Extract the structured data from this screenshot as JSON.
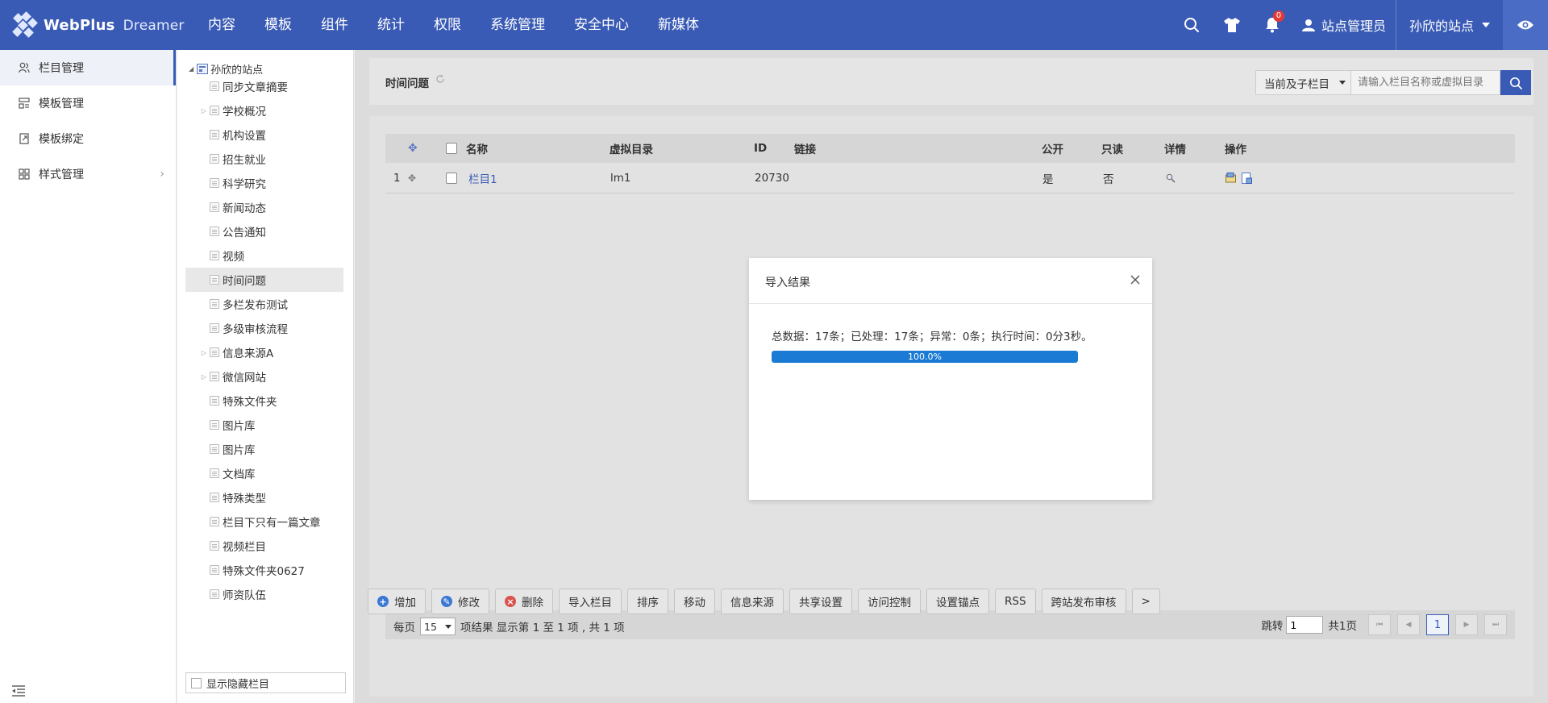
{
  "app": {
    "logo_name": "WebPlus",
    "logo_sub": "Dreamer"
  },
  "nav": {
    "items": [
      "内容",
      "模板",
      "组件",
      "统计",
      "权限",
      "系统管理",
      "安全中心",
      "新媒体"
    ]
  },
  "header": {
    "notification_count": "0",
    "user_name": "站点管理员",
    "site_name": "孙欣的站点"
  },
  "sidebar": {
    "items": [
      {
        "label": "栏目管理",
        "icon": "users-icon",
        "active": true
      },
      {
        "label": "模板管理",
        "icon": "template-icon"
      },
      {
        "label": "模板绑定",
        "icon": "bind-icon"
      },
      {
        "label": "样式管理",
        "icon": "style-icon",
        "has_children": true
      }
    ]
  },
  "tree": {
    "root": "孙欣的站点",
    "items": [
      {
        "label": "同步文章摘要"
      },
      {
        "label": "学校概况",
        "expandable": true
      },
      {
        "label": "机构设置"
      },
      {
        "label": "招生就业"
      },
      {
        "label": "科学研究"
      },
      {
        "label": "新闻动态"
      },
      {
        "label": "公告通知"
      },
      {
        "label": "视频"
      },
      {
        "label": "时间问题",
        "selected": true
      },
      {
        "label": "多栏发布测试"
      },
      {
        "label": "多级审核流程"
      },
      {
        "label": "信息来源A",
        "expandable": true
      },
      {
        "label": "微信网站",
        "expandable": true
      },
      {
        "label": "特殊文件夹"
      },
      {
        "label": "图片库"
      },
      {
        "label": "图片库"
      },
      {
        "label": "文档库"
      },
      {
        "label": "特殊类型"
      },
      {
        "label": "栏目下只有一篇文章"
      },
      {
        "label": "视频栏目"
      },
      {
        "label": "特殊文件夹0627"
      },
      {
        "label": "师资队伍"
      }
    ],
    "show_hidden_label": "显示隐藏栏目"
  },
  "main": {
    "title": "时间问题",
    "scope": "当前及子栏目",
    "search_placeholder": "请输入栏目名称或虚拟目录",
    "table": {
      "headers": {
        "name": "名称",
        "vdir": "虚拟目录",
        "id": "ID",
        "link": "链接",
        "public": "公开",
        "readonly": "只读",
        "detail": "详情",
        "ops": "操作"
      },
      "rows": [
        {
          "index": "1",
          "name": "栏目1",
          "vdir": "lm1",
          "id": "20730",
          "link": "",
          "public": "是",
          "readonly": "否"
        }
      ]
    },
    "pager": {
      "per_page_label": "每页",
      "per_page_value": "15",
      "summary": "项结果 显示第 1 至 1 项 , 共 1 项",
      "jump_label": "跳转",
      "jump_value": "1",
      "total_pages": "共1页",
      "current_page": "1"
    },
    "actions": {
      "add": "增加",
      "edit": "修改",
      "delete": "删除",
      "import": "导入栏目",
      "sort": "排序",
      "move": "移动",
      "source": "信息来源",
      "share": "共享设置",
      "access": "访问控制",
      "anchor": "设置锚点",
      "rss": "RSS",
      "cross": "跨站发布审核",
      "more": ">"
    }
  },
  "modal": {
    "title": "导入结果",
    "message": "总数据：17条；已处理：17条；异常：0条；执行时间：0分3秒。",
    "progress_label": "100.0%",
    "progress_value": 1.0
  },
  "colors": {
    "brand": "#3a5bb5",
    "progress": "#1a7ad4",
    "badge": "#e53935"
  }
}
